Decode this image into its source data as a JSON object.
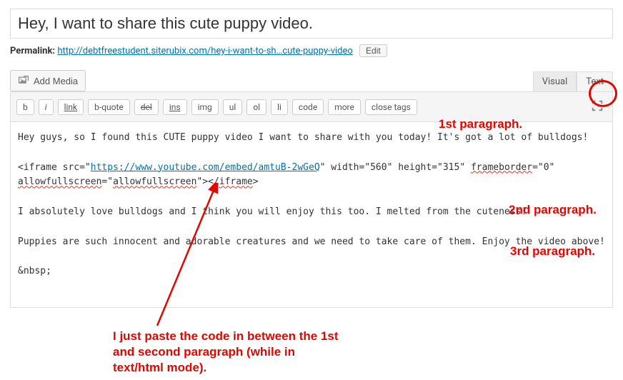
{
  "title": {
    "value": "Hey, I want to share this cute puppy video."
  },
  "permalink": {
    "label": "Permalink:",
    "url_text": "http://debtfreestudent.siterubix.com/hey-i-want-to-sh…cute-puppy-video",
    "edit_label": "Edit"
  },
  "media": {
    "add_label": "Add Media"
  },
  "tabs": {
    "visual": "Visual",
    "text": "Text"
  },
  "toolbar": {
    "b": "b",
    "i": "i",
    "link": "link",
    "bquote": "b-quote",
    "del": "del",
    "ins": "ins",
    "img": "img",
    "ul": "ul",
    "ol": "ol",
    "li": "li",
    "code": "code",
    "more": "more",
    "close_tags": "close tags"
  },
  "content": {
    "p1": "Hey guys, so I found this CUTE puppy video I want to share with you today! It's got a lot of bulldogs!",
    "iframe_open": "<iframe src=\"",
    "iframe_url": "https://www.youtube.com/embed/amtuB-2wGeQ",
    "iframe_mid": "\" width=\"560\" height=\"315\" ",
    "iframe_fb": "frameborder",
    "iframe_fb_val": "=\"0\" ",
    "iframe_afs": "allowfullscreen",
    "iframe_afs_mid": "=\"",
    "iframe_afs2": "allowfullscreen",
    "iframe_close1": "\"></",
    "iframe_tag": "iframe",
    "iframe_close2": ">",
    "p2": "I absolutely love bulldogs and I think you will enjoy this too. I melted from the cuteness!",
    "p3": "Puppies are such innocent and adorable creatures and we need to take care of them. Enjoy the video above!",
    "nbsp": "&nbsp;"
  },
  "annotations": {
    "p1": "1st paragraph.",
    "p2": "2nd paragraph.",
    "p3": "3rd paragraph.",
    "caption_l1": "I just paste the code in between the 1st",
    "caption_l2": "and second paragraph (while in",
    "caption_l3": "text/html mode)."
  }
}
